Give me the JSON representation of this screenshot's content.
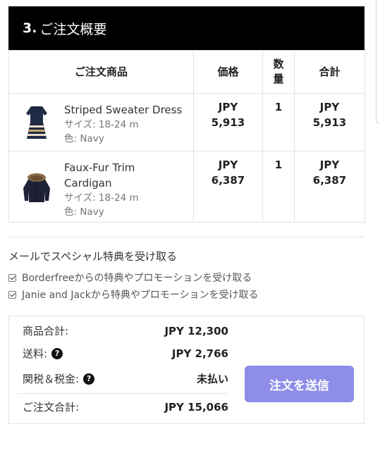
{
  "section": {
    "number": "3.",
    "title": "ご注文概要"
  },
  "table": {
    "headers": {
      "product": "ご注文商品",
      "price": "価格",
      "qty": "数量",
      "total": "合計"
    },
    "rows": [
      {
        "name": "Striped Sweater Dress",
        "size": "サイズ: 18-24 m",
        "color": "色: Navy",
        "price_currency": "JPY",
        "price_amount": "5,913",
        "qty": "1",
        "total_currency": "JPY",
        "total_amount": "5,913",
        "thumbnail_icon": "striped-dress-icon"
      },
      {
        "name": "Faux-Fur Trim Cardigan",
        "size": "サイズ: 18-24 m",
        "color": "色: Navy",
        "price_currency": "JPY",
        "price_amount": "6,387",
        "qty": "1",
        "total_currency": "JPY",
        "total_amount": "6,387",
        "thumbnail_icon": "fur-cardigan-icon"
      }
    ]
  },
  "optin": {
    "title": "メールでスペシャル特典を受け取る",
    "options": [
      {
        "label": "Borderfreeからの特典やプロモーションを受け取る",
        "checked": true
      },
      {
        "label": "Janie and Jackから特典やプロモーションを受け取る",
        "checked": true
      }
    ]
  },
  "summary": {
    "subtotal_label": "商品合計:",
    "subtotal_value": "JPY 12,300",
    "shipping_label": "送料:",
    "shipping_value": "JPY 2,766",
    "duties_label": "関税＆税金:",
    "duties_value": "未払い",
    "total_label": "ご注文合計:",
    "total_value": "JPY 15,066",
    "help_glyph": "?"
  },
  "submit": {
    "label": "注文を送信"
  },
  "colors": {
    "header_bg": "#000000",
    "button_bg": "#8e8ee8",
    "border": "#e3e3e3"
  }
}
